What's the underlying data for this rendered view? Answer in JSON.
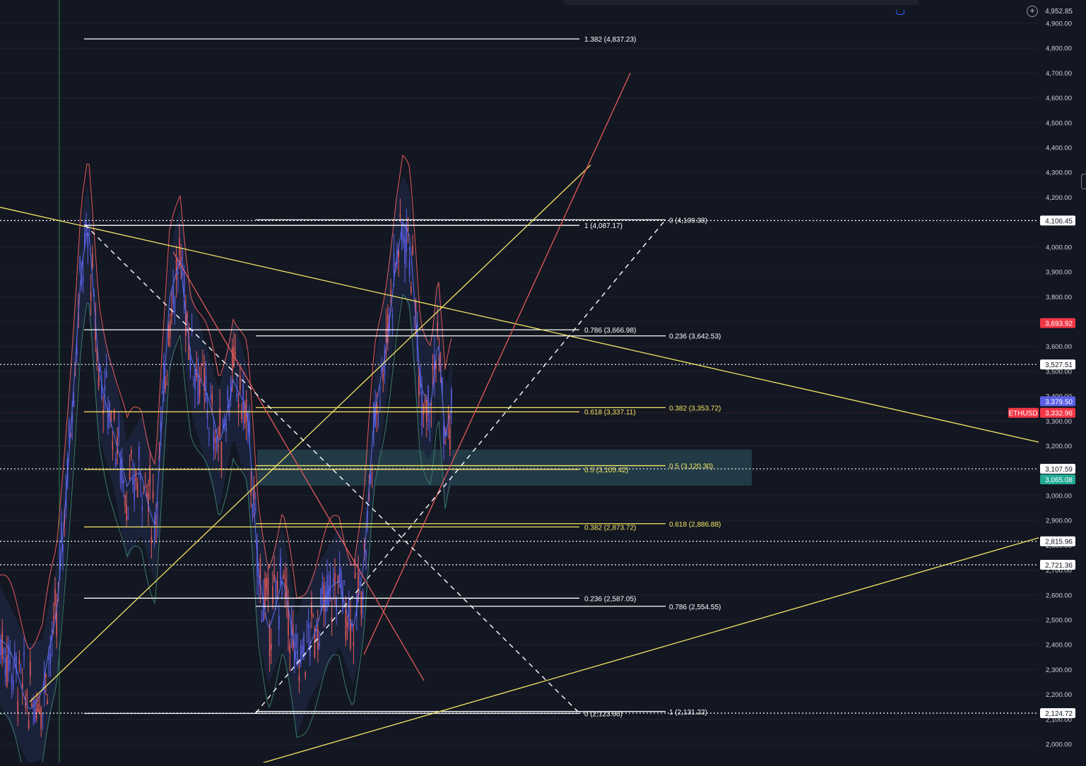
{
  "chart_data": {
    "type": "candlestick",
    "symbol": "ETHUSD",
    "ylim": [
      1960,
      5010
    ],
    "grid": true,
    "price_axis_ticks": [
      "2,000.00",
      "2,100.00",
      "2,200.00",
      "2,300.00",
      "2,400.00",
      "2,500.00",
      "2,600.00",
      "2,700.00",
      "2,800.00",
      "2,900.00",
      "3,000.00",
      "3,100.00",
      "3,200.00",
      "3,300.00",
      "3,400.00",
      "3,500.00",
      "3,600.00",
      "3,700.00",
      "3,800.00",
      "3,900.00",
      "4,000.00",
      "4,100.00",
      "4,200.00",
      "4,300.00",
      "4,400.00",
      "4,500.00",
      "4,600.00",
      "4,700.00",
      "4,800.00",
      "4,900.00"
    ],
    "price_badges": [
      {
        "label": "4,952.85",
        "price": 4952.85,
        "color": "#131722",
        "text_color": "#d1d4dc"
      },
      {
        "label": "4,106.45",
        "price": 4106.45,
        "color": "#ffffff",
        "text_color": "#131722"
      },
      {
        "label": "3,693.92",
        "price": 3693.92,
        "color": "#f23645",
        "text_color": "#ffffff"
      },
      {
        "label": "3,527.51",
        "price": 3527.51,
        "color": "#ffffff",
        "text_color": "#131722"
      },
      {
        "label": "3,379.50",
        "price": 3379.5,
        "color": "#5b5fe6",
        "text_color": "#ffffff"
      },
      {
        "label": "3,332.96",
        "price": 3332.96,
        "color": "#f23645",
        "text_color": "#ffffff"
      },
      {
        "label": "3,107.59",
        "price": 3107.59,
        "color": "#ffffff",
        "text_color": "#131722"
      },
      {
        "label": "3,065.08",
        "price": 3065.08,
        "color": "#22ab94",
        "text_color": "#ffffff"
      },
      {
        "label": "2,815.96",
        "price": 2815.96,
        "color": "#ffffff",
        "text_color": "#131722"
      },
      {
        "label": "2,721.36",
        "price": 2721.36,
        "color": "#ffffff",
        "text_color": "#131722"
      },
      {
        "label": "2,124.72",
        "price": 2124.72,
        "color": "#ffffff",
        "text_color": "#131722"
      }
    ],
    "symbol_tag": {
      "label": "ETHUSD",
      "price": 3332.96,
      "color": "#f23645"
    },
    "horizontal_dotted_levels": [
      4106.45,
      3527.51,
      3107.59,
      2815.96,
      2721.36,
      2124.72
    ],
    "fib_set_1": {
      "color_default": "#ffffff",
      "levels": [
        {
          "label": "1.382 (4,837.23)",
          "price": 4837.23,
          "color": "#ffffff"
        },
        {
          "label": "1 (4,087.17)",
          "price": 4087.17,
          "color": "#ffffff"
        },
        {
          "label": "0.786 (3,666.98)",
          "price": 3666.98,
          "color": "#ffffff"
        },
        {
          "label": "0.618 (3,337.11)",
          "price": 3337.11,
          "color": "#f5e663"
        },
        {
          "label": "0.5 (3,105.42)",
          "price": 3105.42,
          "color": "#f5e663"
        },
        {
          "label": "0.382 (2,873.72)",
          "price": 2873.72,
          "color": "#f5e663"
        },
        {
          "label": "0.236 (2,587.05)",
          "price": 2587.05,
          "color": "#ffffff"
        },
        {
          "label": "0 (2,123.66)",
          "price": 2123.66,
          "color": "#ffffff"
        }
      ]
    },
    "fib_set_2": {
      "levels": [
        {
          "label": "0 (4,109.38)",
          "price": 4109.38,
          "color": "#ffffff"
        },
        {
          "label": "0.236 (3,642.53)",
          "price": 3642.53,
          "color": "#ffffff"
        },
        {
          "label": "0.382 (3,353.72)",
          "price": 3353.72,
          "color": "#f5e663"
        },
        {
          "label": "0.5 (3,120.30)",
          "price": 3120.3,
          "color": "#f5e663"
        },
        {
          "label": "0.618 (2,886.88)",
          "price": 2886.88,
          "color": "#f5e663"
        },
        {
          "label": "0.786 (2,554.55)",
          "price": 2554.55,
          "color": "#ffffff"
        },
        {
          "label": "1 (2,131.22)",
          "price": 2131.22,
          "color": "#ffffff"
        }
      ]
    },
    "zone": {
      "from": 3040,
      "to": 3185,
      "color": "#2a4a55"
    },
    "colors": {
      "up_wick": "#e45a5a",
      "candle_blue": "#5b5fe6",
      "band_upper": "#e45a5a",
      "band_mid": "#5b6ff0",
      "band_lower": "#3a7a6a",
      "trend_yellow": "#f5e663",
      "trend_red": "#e45a5a",
      "dashed": "#ffffff",
      "grid": "#1f2330"
    }
  }
}
